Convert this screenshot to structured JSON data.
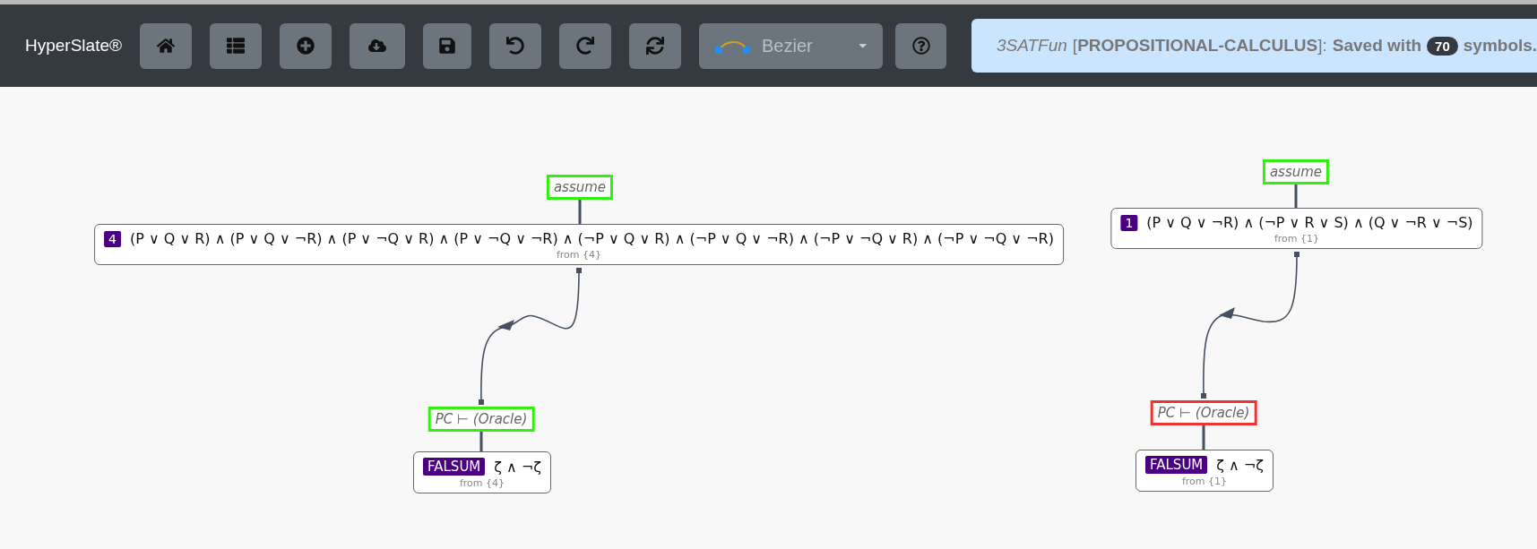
{
  "toolbar": {
    "brand": "HyperSlate®",
    "link_style": {
      "label": "Bezier"
    },
    "message": {
      "document": "3SATFun",
      "logic": "[**PROPOSITIONAL-CALCULUS**]:",
      "prefix": "Saved with",
      "count": "70",
      "suffix": "symbols."
    }
  },
  "proofs": [
    {
      "assumption": {
        "label": "assume",
        "color": "#33ee11"
      },
      "formula": {
        "number": "4",
        "text": "(P ∨ Q ∨ R) ∧ (P ∨ Q ∨ ¬R) ∧ (P ∨ ¬Q ∨ R) ∧ (P ∨ ¬Q ∨ ¬R) ∧ (¬P ∨ Q ∨ R) ∧ (¬P ∨ Q ∨ ¬R) ∧ (¬P ∨ ¬Q ∨ R) ∧ (¬P ∨ ¬Q ∨ ¬R)",
        "from_label": "from",
        "from_ref": "{4}"
      },
      "inference": {
        "label": "PC ⊢ (Oracle)",
        "color": "#33ee11"
      },
      "conclusion": {
        "tag": "FALSUM",
        "text": "ζ ∧ ¬ζ",
        "from_label": "from",
        "from_ref": "{4}"
      }
    },
    {
      "assumption": {
        "label": "assume",
        "color": "#33ee11"
      },
      "formula": {
        "number": "1",
        "text": "(P ∨ Q ∨ ¬R) ∧ (¬P ∨ R ∨ S) ∧ (Q ∨ ¬R ∨ ¬S)",
        "from_label": "from",
        "from_ref": "{1}"
      },
      "inference": {
        "label": "PC ⊢ (Oracle)",
        "color": "#ee3333"
      },
      "conclusion": {
        "tag": "FALSUM",
        "text": "ζ ∧ ¬ζ",
        "from_label": "from",
        "from_ref": "{1}"
      }
    }
  ]
}
